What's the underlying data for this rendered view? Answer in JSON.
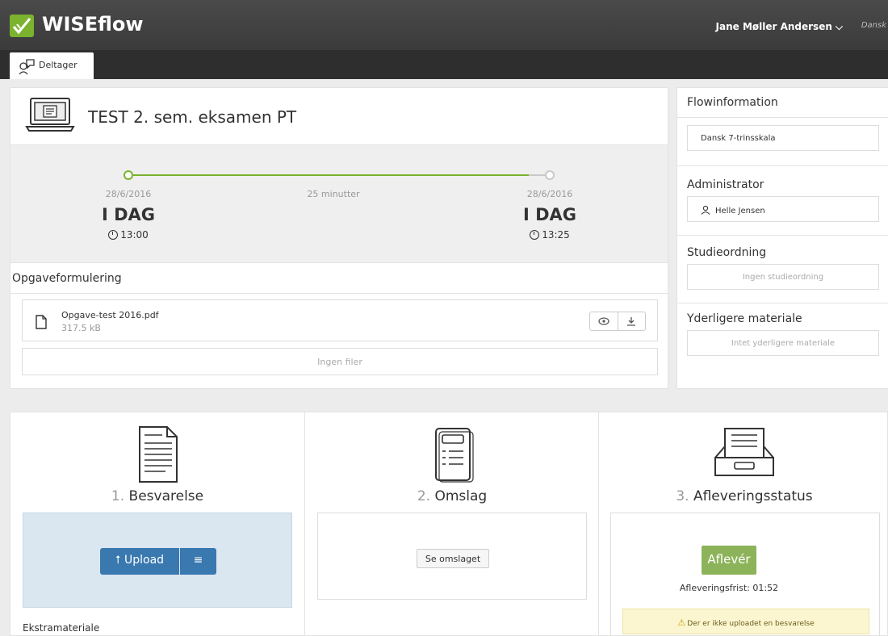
{
  "header": {
    "app_name": "WISEflow",
    "user_name": "Jane Møller Andersen",
    "language_text": "Dansk"
  },
  "tabs": [
    {
      "label": "Deltager"
    }
  ],
  "exam": {
    "title": "TEST 2. sem. eksamen PT",
    "timeline": {
      "start_date": "28/6/2016",
      "start_label": "I DAG",
      "start_time": "13:00",
      "duration": "25 minutter",
      "end_date": "28/6/2016",
      "end_label": "I DAG",
      "end_time": "13:25"
    },
    "assignment_heading": "Opgaveformulering",
    "file": {
      "name": "Opgave-test 2016.pdf",
      "size": "317.5 kB"
    },
    "no_files": "Ingen filer"
  },
  "flowinfo": {
    "title": "Flowinformation",
    "grading_scale": "Dansk 7-trinsskala",
    "admin_title": "Administrator",
    "admin_name": "Helle Jensen",
    "study_title": "Studieordning",
    "study_value": "Ingen studieordning",
    "extra_title": "Yderligere materiale",
    "extra_value": "Intet yderligere materiale"
  },
  "steps": {
    "answer": {
      "num": "1.",
      "title": "Besvarelse",
      "upload_label": "Upload",
      "extra_label": "Ekstramateriale"
    },
    "cover": {
      "num": "2.",
      "title": "Omslag",
      "view_label": "Se omslaget"
    },
    "status": {
      "num": "3.",
      "title": "Afleveringsstatus",
      "deliver_label": "Aflevér",
      "deadline": "Afleveringsfrist: 01:52",
      "warning": "Der er ikke uploadet en besvarelse"
    }
  },
  "colors": {
    "brand_green": "#7bb32e",
    "primary_blue": "#3a78b0",
    "deliver_green": "#8cb35a"
  }
}
